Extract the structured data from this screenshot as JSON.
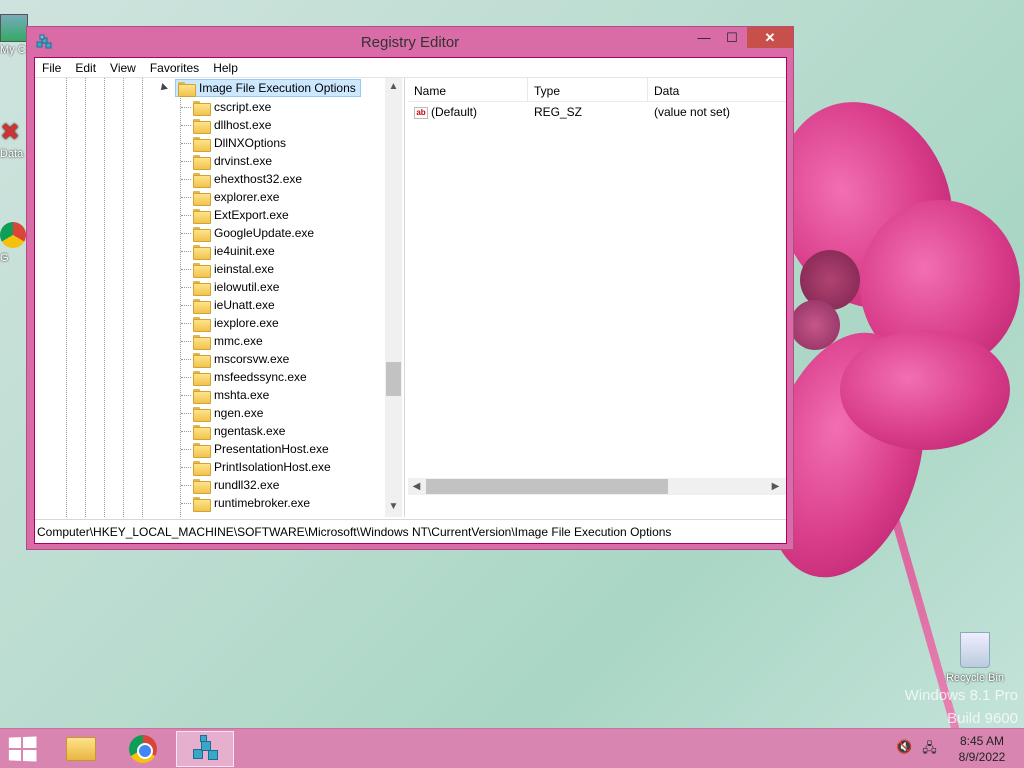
{
  "window": {
    "title": "Registry Editor",
    "minimize_glyph": "—",
    "maximize_glyph": "☐",
    "close_glyph": "✕"
  },
  "menu": [
    "File",
    "Edit",
    "View",
    "Favorites",
    "Help"
  ],
  "tree": {
    "selected_key": "Image File Execution Options",
    "children": [
      "cscript.exe",
      "dllhost.exe",
      "DllNXOptions",
      "drvinst.exe",
      "ehexthost32.exe",
      "explorer.exe",
      "ExtExport.exe",
      "GoogleUpdate.exe",
      "ie4uinit.exe",
      "ieinstal.exe",
      "ielowutil.exe",
      "ieUnatt.exe",
      "iexplore.exe",
      "mmc.exe",
      "mscorsvw.exe",
      "msfeedssync.exe",
      "mshta.exe",
      "ngen.exe",
      "ngentask.exe",
      "PresentationHost.exe",
      "PrintIsolationHost.exe",
      "rundll32.exe",
      "runtimebroker.exe"
    ]
  },
  "list": {
    "columns": {
      "name": "Name",
      "type": "Type",
      "data": "Data"
    },
    "rows": [
      {
        "icon": "ab",
        "name": "(Default)",
        "type": "REG_SZ",
        "data": "(value not set)"
      }
    ]
  },
  "statusbar": {
    "path": "Computer\\HKEY_LOCAL_MACHINE\\SOFTWARE\\Microsoft\\Windows NT\\CurrentVersion\\Image File Execution Options"
  },
  "desktop": {
    "icons_partial": [
      "My C",
      "Data",
      "G"
    ],
    "recycle_bin": "Recycle Bin",
    "watermark_line1": "Windows 8.1 Pro",
    "watermark_line2": "Build 9600"
  },
  "taskbar": {
    "time": "8:45 AM",
    "date": "8/9/2022",
    "apps": [
      "file-explorer",
      "chrome",
      "registry-editor"
    ],
    "active_app": "registry-editor"
  },
  "colors": {
    "window_frame": "#d96ca6",
    "close_button": "#c7504a",
    "selection": "#cce8ff",
    "taskbar": "#d985b2"
  }
}
